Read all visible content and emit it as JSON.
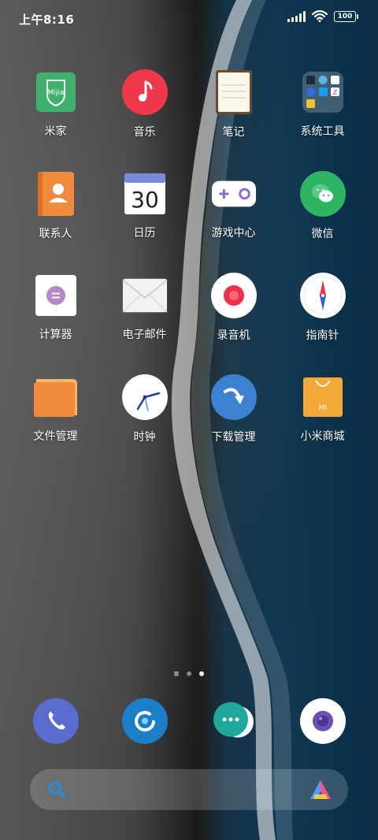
{
  "status_bar": {
    "time": "上午8:16",
    "battery": "100"
  },
  "apps": [
    {
      "label": "米家",
      "icon": "mijia-icon",
      "icon_text": "Mijia"
    },
    {
      "label": "音乐",
      "icon": "music-icon"
    },
    {
      "label": "笔记",
      "icon": "notes-icon"
    },
    {
      "label": "系统工具",
      "icon": "system-tools-folder-icon"
    },
    {
      "label": "联系人",
      "icon": "contacts-icon"
    },
    {
      "label": "日历",
      "icon": "calendar-icon",
      "icon_text": "30"
    },
    {
      "label": "游戏中心",
      "icon": "game-center-icon"
    },
    {
      "label": "微信",
      "icon": "wechat-icon"
    },
    {
      "label": "计算器",
      "icon": "calculator-icon"
    },
    {
      "label": "电子邮件",
      "icon": "email-icon"
    },
    {
      "label": "录音机",
      "icon": "recorder-icon"
    },
    {
      "label": "指南针",
      "icon": "compass-icon"
    },
    {
      "label": "文件管理",
      "icon": "file-manager-icon"
    },
    {
      "label": "时钟",
      "icon": "clock-icon"
    },
    {
      "label": "下载管理",
      "icon": "download-manager-icon"
    },
    {
      "label": "小米商城",
      "icon": "mi-store-icon",
      "icon_text": "MI"
    }
  ],
  "page_indicator": {
    "pages": 3,
    "active": 3
  },
  "dock": [
    {
      "icon": "phone-icon"
    },
    {
      "icon": "browser-icon"
    },
    {
      "icon": "messages-icon"
    },
    {
      "icon": "camera-icon"
    }
  ],
  "colors": {
    "mijia": "#3fb16d",
    "music": "#f0384a",
    "contacts": "#f18a3c",
    "wechat": "#2db563",
    "calculator": "#b58ac4",
    "recorder": "#f0304a",
    "download": "#3d82d2",
    "store": "#f3a93a",
    "phone": "#5a6cd0",
    "browser": "#1d7ec8",
    "messages": "#1ea79a",
    "camera": "#6a4fb5"
  }
}
